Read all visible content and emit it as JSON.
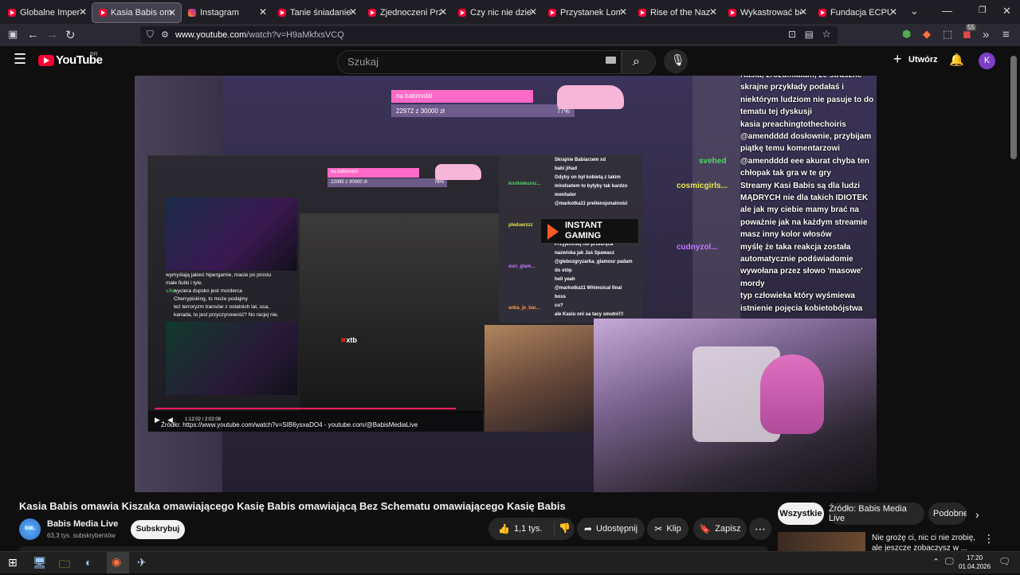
{
  "browser": {
    "tabs": [
      {
        "label": "Globalne Imperium B",
        "icon": "youtube-icon"
      },
      {
        "label": "Kasia Babis omawia K",
        "icon": "youtube-icon",
        "active": true
      },
      {
        "label": "Instagram",
        "icon": "instagram-icon"
      },
      {
        "label": "Tanie śniadanie w pie",
        "icon": "youtube-icon"
      },
      {
        "label": "Zjednoczeni Przeciw",
        "icon": "youtube-icon"
      },
      {
        "label": "Czy nic nie dzieje się",
        "icon": "youtube-icon"
      },
      {
        "label": "Przystanek Lombard",
        "icon": "youtube-icon"
      },
      {
        "label": "Rise of the Nazis and",
        "icon": "youtube-icon"
      },
      {
        "label": "Wykastrować bezdom",
        "icon": "youtube-icon"
      },
      {
        "label": "Fundacja ECPU Polsk",
        "icon": "youtube-icon"
      }
    ],
    "url_host": "www.youtube.com",
    "url_path": "/watch?v=H9aMkfxsVCQ",
    "extension_badge": "55"
  },
  "youtube": {
    "logo_text": "YouTube",
    "region": "BR",
    "search_placeholder": "Szukaj",
    "create_label": "Utwórz",
    "avatar_letter": "K"
  },
  "video": {
    "goal": {
      "title": "na babimobil",
      "progress_text": "22972 z 30000 zł",
      "percent_text": "77%",
      "percent": 77
    },
    "inner_goal": {
      "title": "na babimobil",
      "progress_text": "22085 z 30000 zł",
      "percent_text": "76%"
    },
    "inner_left_chat": [
      "wymyślają jakieś hipergamie, macie po prostu",
      "małe fiutki i tyle.",
      "wyciera dupsko jest morderca",
      "Cherrypicking, to może podajmy",
      "też terroryzm transów z ostatnich lat, usa,",
      "kanada, to jest przyczynowość? No racjej nie."
    ],
    "inner_chat_names": [
      "s3ta_"
    ],
    "inner_player_time": "1:12:02 / 2:02:08",
    "source_caption": "Źródło: https://www.youtube.com/watch?v=SIB6ysxaDO4 - youtube.com/@BabisMediaLive",
    "inner_chat": [
      "Skrajnie Babiarzem xd",
      "babi jihad",
      "Gdyby on był kobietą z takim",
      "mindsetem to byłyby tak bardzo",
      "menhater",
      "@markotka11 preliensjonalność",
      "Przyjemniej nie przekręca",
      "nazwiska jak Jaś Spawacz",
      "@glebozgryzarka_glamour padam",
      "do stóp",
      "hell yeah",
      "@markotka11 Whimsical final",
      "boss",
      "co?",
      "ale Kasiu oni sa tacy smutni!!!"
    ],
    "inner_chat_names2": [
      "krotkiekurez...",
      "pleduerzzz",
      "auri_glam...",
      "anka_je_bar..."
    ],
    "sponsor": "INSTANT\nGAMING",
    "sponsor_line1": "INSTANT",
    "sponsor_line2": "GAMING",
    "xtb": "xtb",
    "chat": [
      {
        "name": "",
        "text": "Kasia, zrozumiałam, że straszne"
      },
      {
        "name": "",
        "text": "skrajne przykłady podałaś i"
      },
      {
        "name": "",
        "text": "niektórym ludziom nie pasuje to do"
      },
      {
        "name": "",
        "text": "tematu tej dyskusji"
      },
      {
        "name": "",
        "text": "kasia preachingtothechoiris"
      },
      {
        "name": "",
        "text": "@amendddd dosłownie, przybijam"
      },
      {
        "name": "",
        "text": "piątkę temu komentarzowi"
      },
      {
        "name": "svehed",
        "text": "@amendddd eee akurat chyba ten"
      },
      {
        "name": "",
        "text": "chłopak tak gra w te gry"
      },
      {
        "name": "cosmicgirls...",
        "text": "Streamy Kasi Babis są dla ludzi"
      },
      {
        "name": "",
        "text": "MĄDRYCH nie dla takich IDIOTEK"
      },
      {
        "name": "",
        "text": "ale jak my ciebie mamy brać na"
      },
      {
        "name": "",
        "text": "poważnie jak na każdym streamie"
      },
      {
        "name": "",
        "text": "masz inny kolor włosów"
      },
      {
        "name": "cudnyzol...",
        "text": "myślę że taka reakcja została"
      },
      {
        "name": "",
        "text": "automatycznie podświadomie"
      },
      {
        "name": "",
        "text": "wywołana przez słowo 'masowe'"
      },
      {
        "name": "",
        "text": "mordy"
      },
      {
        "name": "",
        "text": "typ człowieka który wyśmiewa"
      },
      {
        "name": "",
        "text": "istnienie pojęcia kobietobójstwa"
      }
    ]
  },
  "below": {
    "title": "Kasia Babis omawia Kiszaka omawiającego Kasię Babis omawiającą Bez Schematu omawiającego Kasię Babis",
    "channel": "Babis Media Live",
    "subscribers": "63,3 tys. subskrybentów",
    "subscribe_label": "Subskrybuj",
    "likes": "1,1 tys.",
    "share_label": "Udostępnij",
    "clip_label": "Klip",
    "save_label": "Zapisz",
    "chips": [
      "Wszystkie",
      "Źródło: Babis Media Live",
      "Podobne"
    ],
    "rec_title_1": "Nie grożę ci, nic ci nie zrobię,",
    "rec_title_2": "ale jeszcze zobaczysz w ..."
  },
  "taskbar": {
    "time": "17:20",
    "date": "01.04.2026"
  },
  "colors": {
    "youtube_red": "#ff0033",
    "goal_pink": "#ff69c8",
    "avatar": "#7e3fc8"
  }
}
